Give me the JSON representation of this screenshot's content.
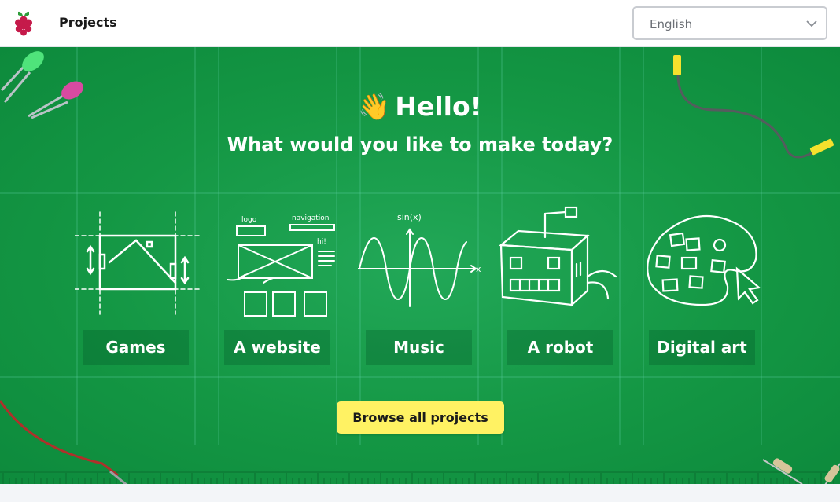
{
  "header": {
    "brand_title": "Projects",
    "language_selected": "English"
  },
  "hero": {
    "greeting": "Hello!",
    "greeting_emoji": "👋",
    "question": "What would you like to make today?",
    "categories": [
      {
        "label": "Games",
        "icon": "games-icon"
      },
      {
        "label": "A website",
        "icon": "website-icon"
      },
      {
        "label": "Music",
        "icon": "music-icon"
      },
      {
        "label": "A robot",
        "icon": "robot-icon"
      },
      {
        "label": "Digital art",
        "icon": "digital-art-icon"
      }
    ],
    "browse_label": "Browse all projects"
  },
  "colors": {
    "hero_green": "#149744",
    "button_yellow": "#fff263",
    "raspberry": "#c51a4a"
  }
}
